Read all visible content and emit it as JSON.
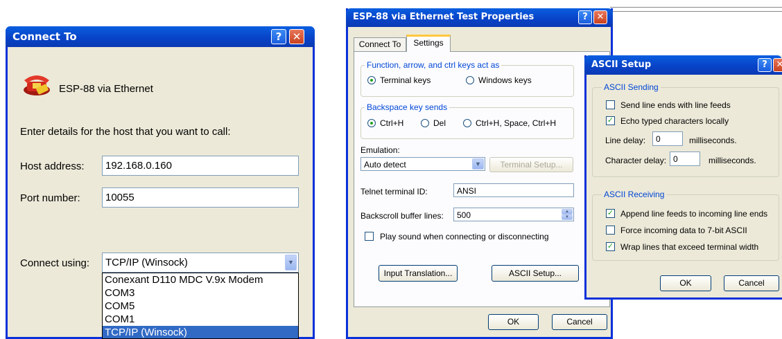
{
  "connect_to": {
    "title": "Connect To",
    "connection_name": "ESP-88 via Ethernet",
    "prompt": "Enter details for the host that you want to call:",
    "host_label": "Host address:",
    "host_value": "192.168.0.160",
    "port_label": "Port number:",
    "port_value": "10055",
    "connect_using_label": "Connect using:",
    "connect_using_value": "TCP/IP (Winsock)",
    "options": [
      "Conexant D110 MDC V.9x Modem",
      "COM3",
      "COM5",
      "COM1",
      "TCP/IP (Winsock)"
    ]
  },
  "properties": {
    "title": "ESP-88 via Ethernet Test Properties",
    "tabs": [
      "Connect To",
      "Settings"
    ],
    "keys_group": "Function, arrow, and ctrl keys act as",
    "terminal_keys": "Terminal keys",
    "windows_keys": "Windows keys",
    "backspace_group": "Backspace key sends",
    "bs_ctrlh": "Ctrl+H",
    "bs_del": "Del",
    "bs_combo": "Ctrl+H, Space, Ctrl+H",
    "emulation_label": "Emulation:",
    "emulation_value": "Auto detect",
    "terminal_setup": "Terminal Setup...",
    "telnet_label": "Telnet terminal ID:",
    "telnet_value": "ANSI",
    "backscroll_label": "Backscroll buffer lines:",
    "backscroll_value": "500",
    "play_sound": "Play sound when connecting or disconnecting",
    "input_translation": "Input Translation...",
    "ascii_setup": "ASCII Setup...",
    "ok": "OK",
    "cancel": "Cancel"
  },
  "ascii_setup": {
    "title": "ASCII Setup",
    "sending_group": "ASCII Sending",
    "send_line_ends": "Send line ends with line feeds",
    "echo_typed": "Echo typed characters locally",
    "line_delay_label": "Line delay:",
    "line_delay_value": "0",
    "line_delay_unit": "milliseconds.",
    "char_delay_label": "Character delay:",
    "char_delay_value": "0",
    "char_delay_unit": "milliseconds.",
    "receiving_group": "ASCII Receiving",
    "append_line_feeds": "Append line feeds to incoming line ends",
    "force_7bit": "Force incoming data to 7-bit ASCII",
    "wrap_lines": "Wrap lines that exceed terminal width",
    "ok": "OK",
    "cancel": "Cancel"
  },
  "icons": {
    "help": "?",
    "close": "✕",
    "dropdown": "▼",
    "check": "✓",
    "spin_up": "▲",
    "spin_down": "▼"
  }
}
